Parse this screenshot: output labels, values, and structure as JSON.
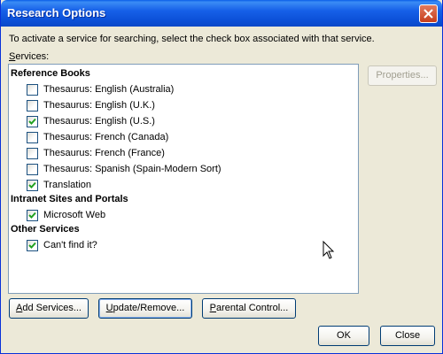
{
  "window": {
    "title": "Research Options"
  },
  "intro": "To activate a service for searching, select the check box associated with that service.",
  "services_label": {
    "prefix": "",
    "accel": "S",
    "suffix": "ervices:"
  },
  "groups": [
    {
      "heading": "Reference Books",
      "items": [
        {
          "label": "Thesaurus: English (Australia)",
          "checked": false
        },
        {
          "label": "Thesaurus: English (U.K.)",
          "checked": false
        },
        {
          "label": "Thesaurus: English (U.S.)",
          "checked": true
        },
        {
          "label": "Thesaurus: French (Canada)",
          "checked": false
        },
        {
          "label": "Thesaurus: French (France)",
          "checked": false
        },
        {
          "label": "Thesaurus: Spanish (Spain-Modern Sort)",
          "checked": false
        },
        {
          "label": "Translation",
          "checked": true
        }
      ]
    },
    {
      "heading": "Intranet Sites and Portals",
      "items": [
        {
          "label": "Microsoft Web",
          "checked": true
        }
      ]
    },
    {
      "heading": "Other Services",
      "items": [
        {
          "label": "Can't find it?",
          "checked": true
        }
      ]
    }
  ],
  "buttons": {
    "properties": "Properties...",
    "add_services": {
      "accel": "A",
      "rest": "dd Services..."
    },
    "update_remove": {
      "accel": "U",
      "rest": "pdate/Remove..."
    },
    "parental_control": {
      "accel": "P",
      "rest": "arental Control..."
    },
    "ok": "OK",
    "close": "Close"
  },
  "colors": {
    "title_bar": "#0b4fd6",
    "check": "#21a121",
    "dialog_bg": "#ece9d8"
  }
}
